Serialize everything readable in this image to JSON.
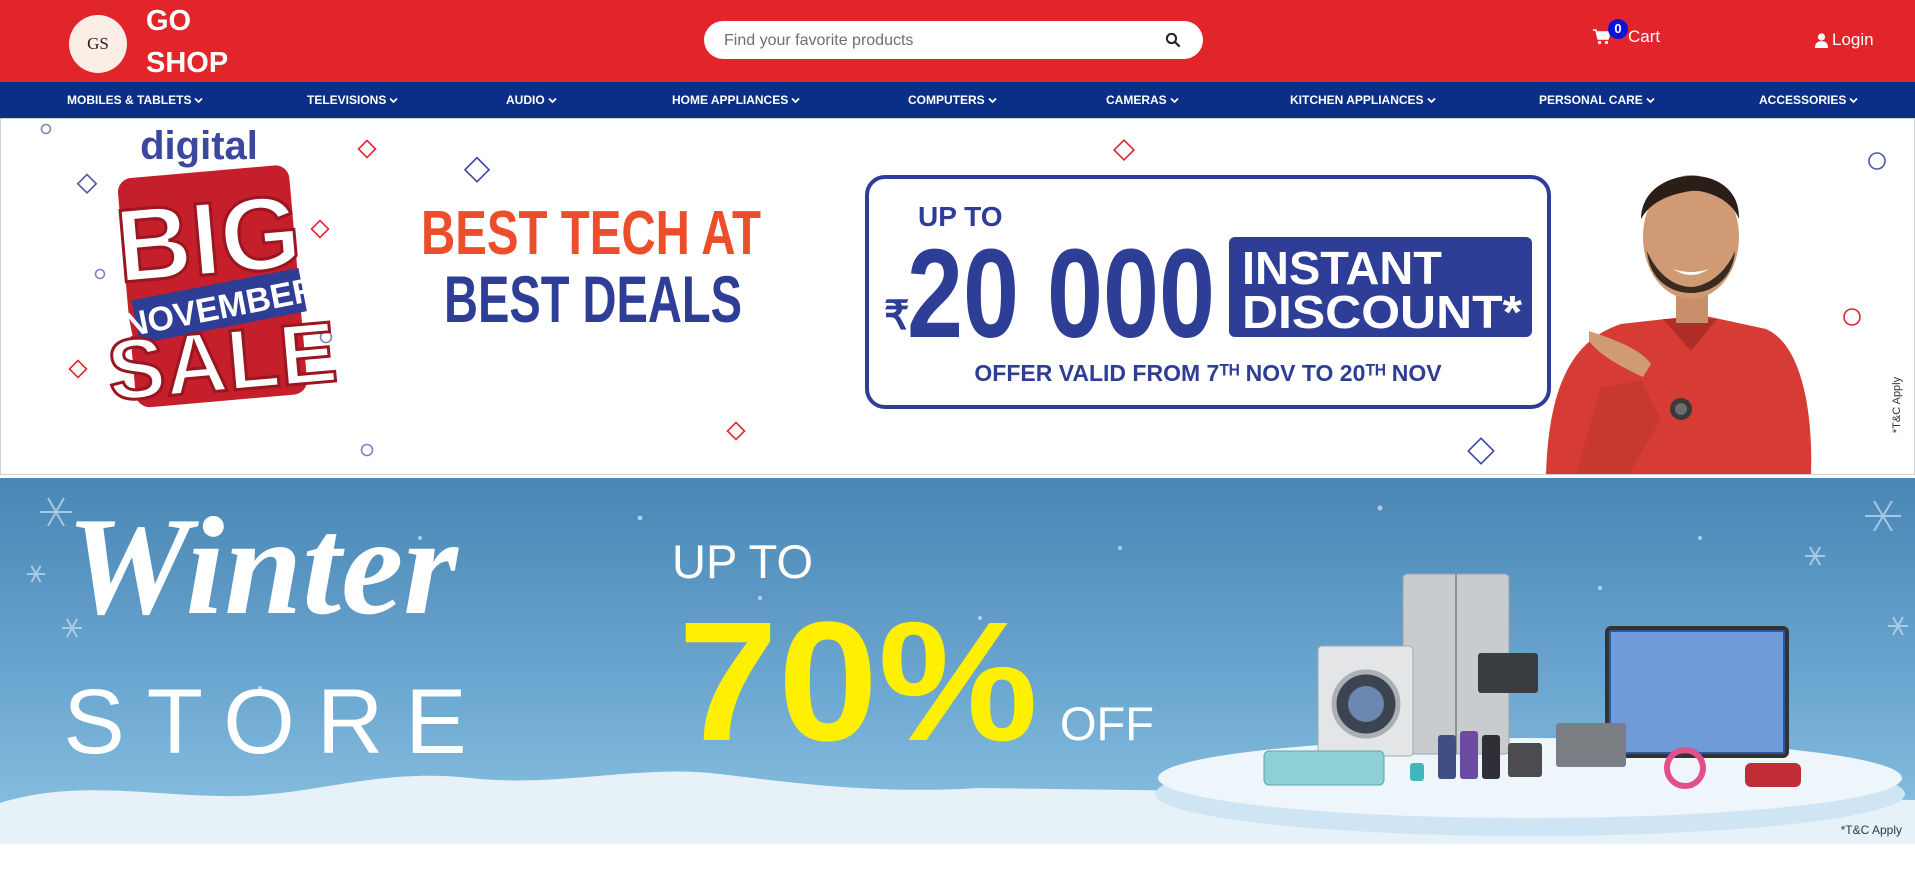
{
  "brand": {
    "logo_initials": "GS",
    "name_line1": "GO",
    "name_line2": "SHOP"
  },
  "search": {
    "placeholder": "Find your favorite products",
    "icon": "search-icon"
  },
  "cart": {
    "count": "0",
    "label": "Cart",
    "icon": "cart-icon"
  },
  "account": {
    "label": "Login",
    "icon": "user-icon"
  },
  "nav": {
    "items": [
      {
        "label": "MOBILES & TABLETS"
      },
      {
        "label": "TELEVISIONS"
      },
      {
        "label": "AUDIO"
      },
      {
        "label": "HOME APPLIANCES"
      },
      {
        "label": "COMPUTERS"
      },
      {
        "label": "CAMERAS"
      },
      {
        "label": "KITCHEN APPLIANCES"
      },
      {
        "label": "PERSONAL CARE"
      },
      {
        "label": "ACCESSORIES"
      }
    ]
  },
  "banner1": {
    "sale_word_digital": "digital",
    "sale_word_big": "BIG",
    "sale_word_november": "NOVEMBER",
    "sale_word_sale": "SALE",
    "tagline_line1": "BEST TECH AT",
    "tagline_line2": "BEST DEALS",
    "upto": "UP TO",
    "currency": "₹",
    "amount": "20 000",
    "discount_line1": "INSTANT",
    "discount_line2": "DISCOUNT*",
    "validity": "OFFER VALID FROM 7ᵀᴴ NOV TO 20ᵀᴴ NOV",
    "terms": "*T&C Apply"
  },
  "banner2": {
    "script_word": "Winter",
    "store_word": "STORE",
    "upto": "UP TO",
    "percent": "70%",
    "off": "OFF",
    "terms": "*T&C Apply"
  },
  "colors": {
    "header": "#e2242b",
    "nav": "#0b2f86",
    "cart_badge": "#0a13d9",
    "deal_blue": "#2e3d96",
    "deal_orange": "#ec4d2b",
    "winter_yellow": "#ffef00"
  }
}
